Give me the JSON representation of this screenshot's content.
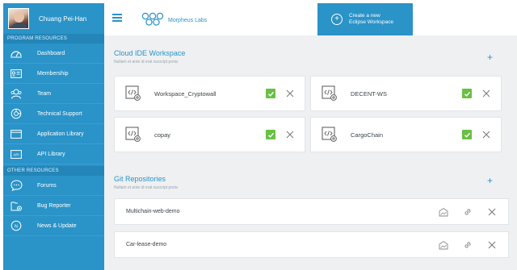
{
  "user": {
    "name": "Chuang Pei-Han"
  },
  "sidebar": {
    "program_header": "PROGRAM RESOURCES",
    "program_items": [
      {
        "label": "Dashboard",
        "icon": "gauge-icon"
      },
      {
        "label": "Membership",
        "icon": "id-card-icon"
      },
      {
        "label": "Team",
        "icon": "team-icon"
      },
      {
        "label": "Technical Support",
        "icon": "support-icon"
      },
      {
        "label": "Application Library",
        "icon": "window-icon"
      },
      {
        "label": "API Library",
        "icon": "api-icon"
      }
    ],
    "other_header": "OTHER RESOURCES",
    "other_items": [
      {
        "label": "Forums",
        "icon": "chat-bubble-icon"
      },
      {
        "label": "Bug Reporter",
        "icon": "bug-report-icon"
      },
      {
        "label": "News & Update",
        "icon": "news-icon"
      }
    ]
  },
  "topbar": {
    "brand": "Morpheus Labs",
    "create_label_line1": "Create a new",
    "create_label_line2": "Eclipse Workspace"
  },
  "workspace_section": {
    "title": "Cloud IDE Workspace",
    "subtitle": "Nullam et ante id erat suscript porta",
    "workspaces": [
      {
        "name": "Workspace_Cryptowall",
        "status": "active"
      },
      {
        "name": "DECENT-WS",
        "status": "active"
      },
      {
        "name": "copay",
        "status": "active"
      },
      {
        "name": "CargoChain",
        "status": "active"
      }
    ]
  },
  "git_section": {
    "title": "Git Repositories",
    "subtitle": "Nullam et ante id erat suscript porta",
    "repos": [
      {
        "name": "Multichain-web-demo"
      },
      {
        "name": "Car-lease-demo"
      }
    ]
  },
  "colors": {
    "accent": "#2a93c8",
    "check": "#6ac044",
    "background": "#eef0f2"
  }
}
